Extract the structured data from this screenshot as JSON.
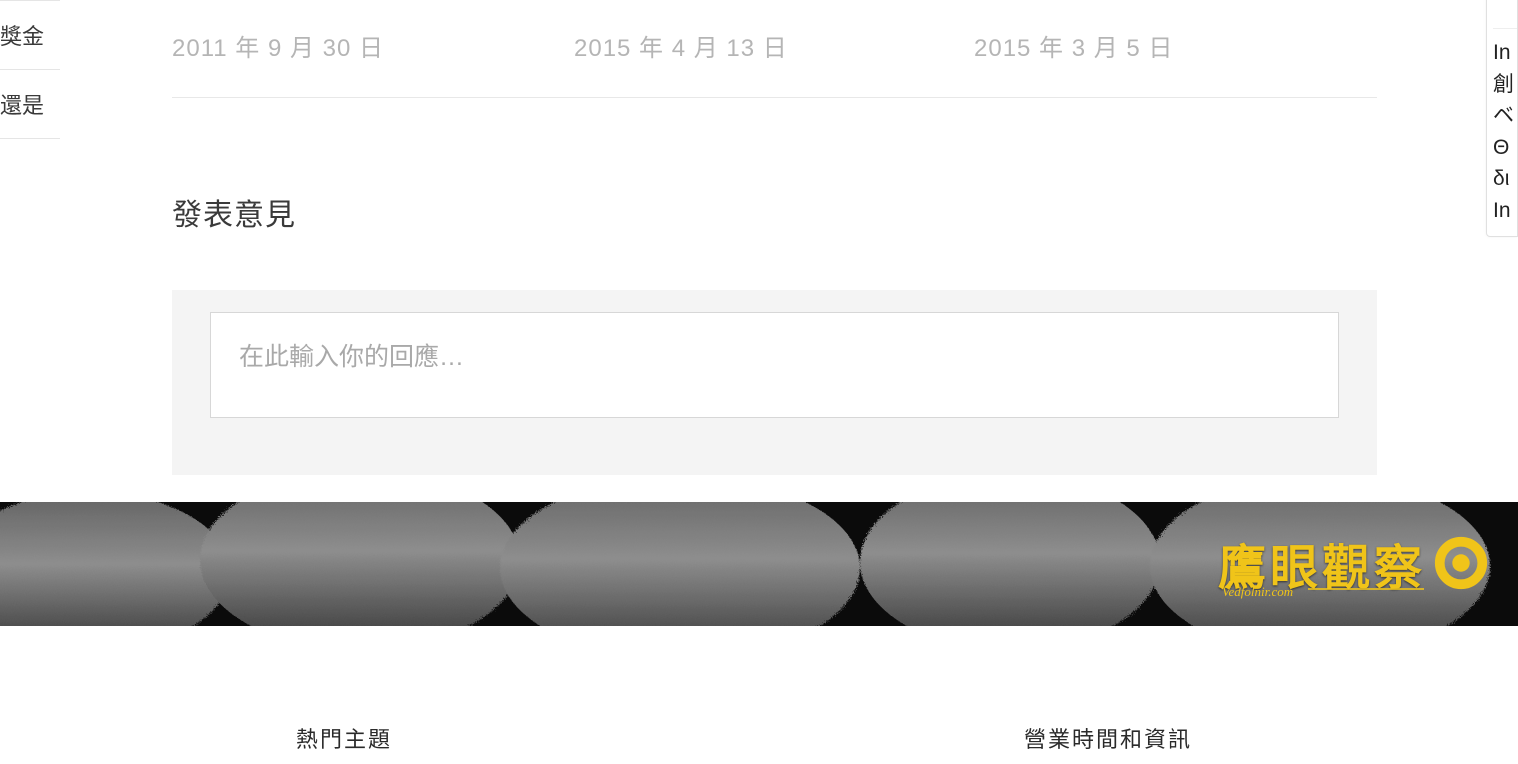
{
  "sidebar": {
    "items": [
      {
        "label": "獎金"
      },
      {
        "label": "還是"
      }
    ]
  },
  "article": {
    "dates": [
      "2011 年 9 月 30 日",
      "2015 年 4 月 13 日",
      "2015 年 3 月 5 日"
    ],
    "comment_heading": "發表意見",
    "comment_placeholder": "在此輸入你的回應…"
  },
  "right_panel": {
    "lines": [
      "In",
      "創",
      "ベ",
      "Θ",
      "δι",
      "In"
    ]
  },
  "banner": {
    "logo_text": "鷹眼觀察",
    "logo_sub": "Vedfolnir.com"
  },
  "footer": {
    "col1_heading": "熱門主題",
    "col2_heading": "營業時間和資訊"
  }
}
